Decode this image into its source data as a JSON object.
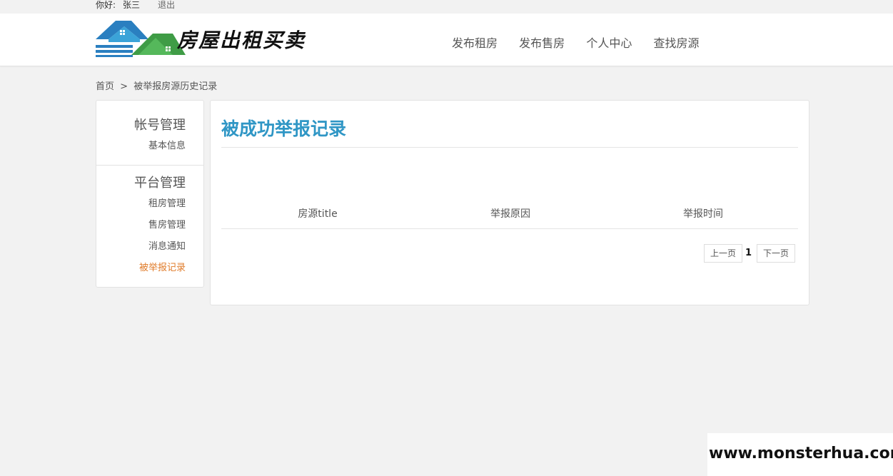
{
  "userbar": {
    "greeting": "你好:",
    "username": "张三",
    "logout_label": "退出"
  },
  "header": {
    "logo_text": "房屋出租买卖",
    "nav": [
      {
        "label": "发布租房"
      },
      {
        "label": "发布售房"
      },
      {
        "label": "个人中心"
      },
      {
        "label": "查找房源"
      }
    ]
  },
  "breadcrumb": {
    "home": "首页",
    "separator": ">",
    "current": "被举报房源历史记录"
  },
  "sidebar": {
    "groups": [
      {
        "title": "帐号管理",
        "items": [
          {
            "label": "基本信息"
          }
        ]
      },
      {
        "title": "平台管理",
        "items": [
          {
            "label": "租房管理"
          },
          {
            "label": "售房管理"
          },
          {
            "label": "消息通知"
          },
          {
            "label": "被举报记录",
            "active": true
          }
        ]
      }
    ]
  },
  "main": {
    "title": "被成功举报记录",
    "columns": [
      "房源title",
      "举报原因",
      "举报时间"
    ],
    "rows": [],
    "pager": {
      "prev_label": "上一页",
      "current_page": "1",
      "next_label": "下一页"
    }
  },
  "watermark": {
    "text": "www.monsterhua.com"
  },
  "colors": {
    "accent": "#2f96c5",
    "active_item": "#e07b29",
    "logo_blue": "#2a7fc0",
    "logo_green": "#4caf50"
  }
}
